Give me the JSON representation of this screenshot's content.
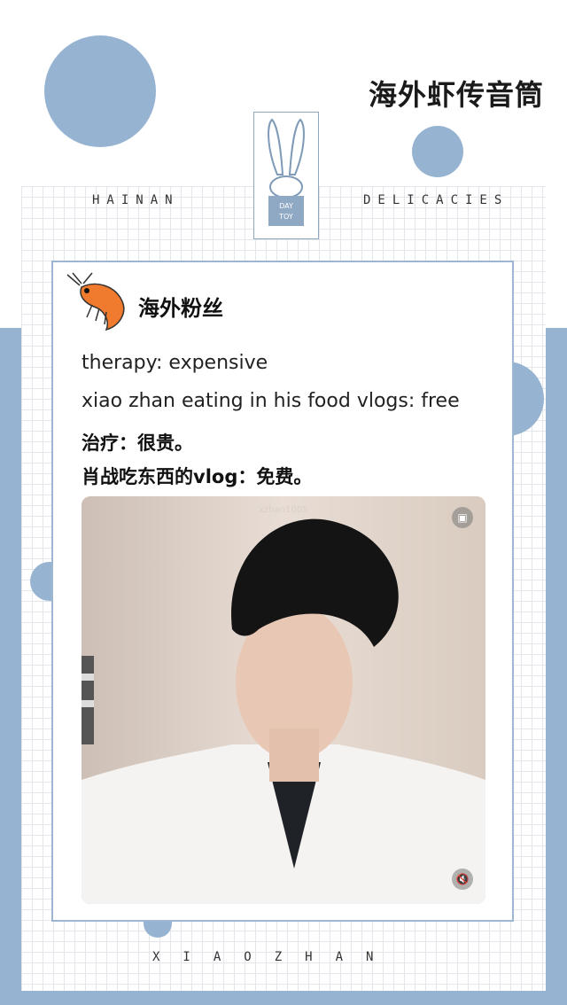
{
  "header": {
    "title": "海外虾传音筒"
  },
  "banner": {
    "left_word": "HAINAN",
    "right_word": "DELICACIES"
  },
  "logo": {
    "line1": "DAY",
    "line2": "TOY"
  },
  "card": {
    "section_title": "海外粉丝",
    "lines_en": [
      "therapy: expensive",
      "xiao zhan eating in his food vlogs: free"
    ],
    "lines_zh": [
      "治疗：很贵。",
      "肖战吃东西的vlog：免费。"
    ],
    "photo": {
      "watermark": "xzhan1005"
    }
  },
  "footer": {
    "text": "XIAOZHAN"
  },
  "colors": {
    "accent": "#96b4d2",
    "border": "#9db7d3",
    "grid": "#e3e6ea"
  },
  "icons": [
    "shrimp-icon",
    "rabbit-logo-icon",
    "pip-icon",
    "mute-icon"
  ]
}
